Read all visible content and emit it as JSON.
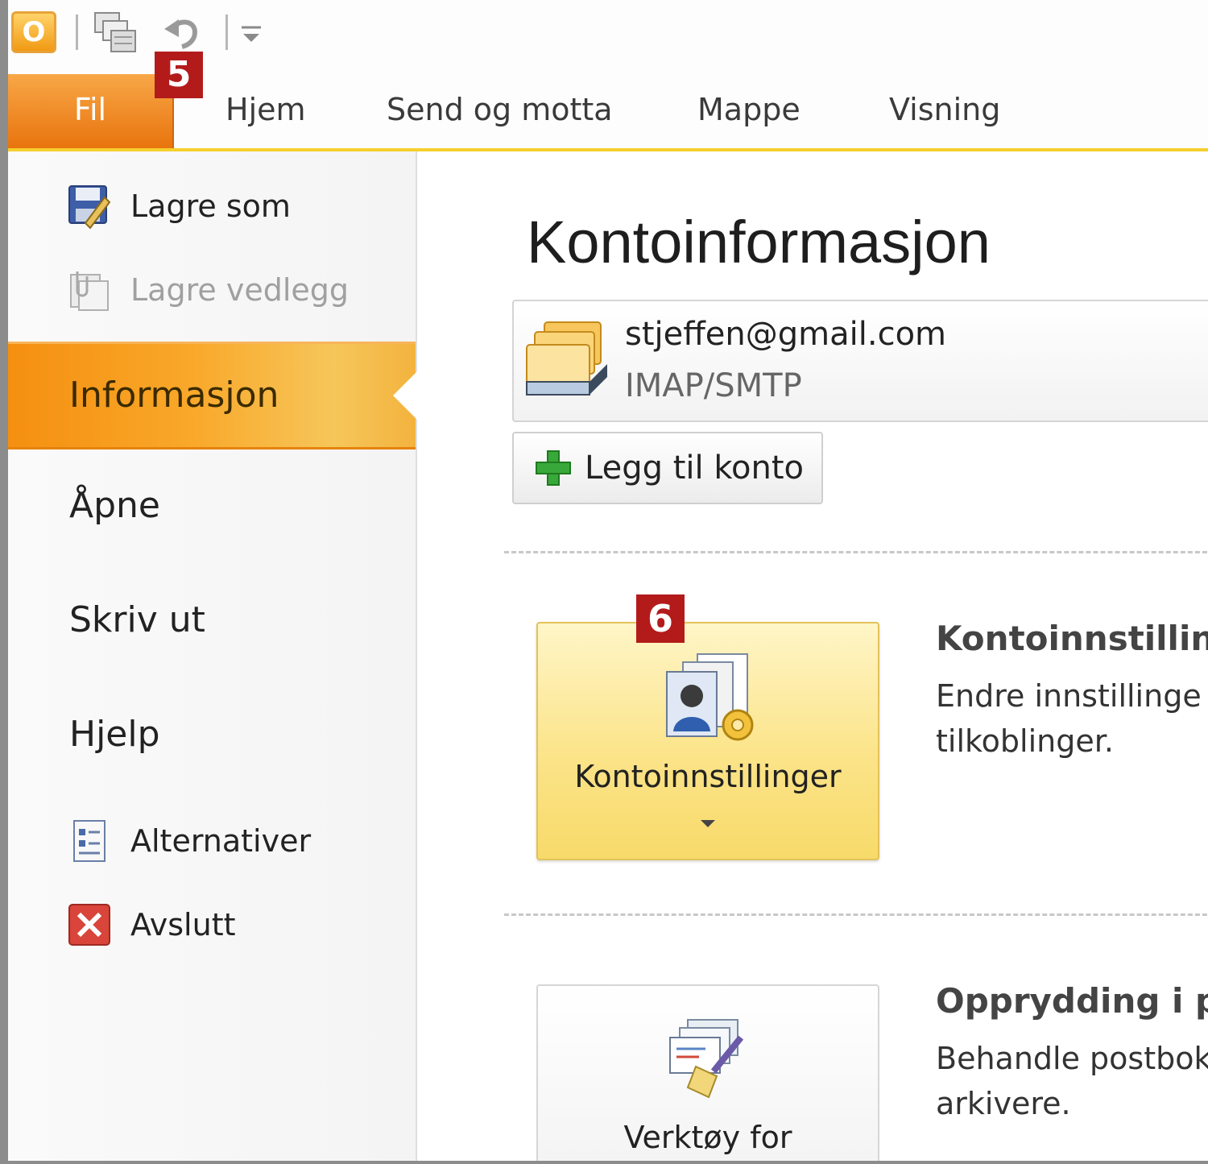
{
  "quick_access": {
    "logo_letter": "O",
    "icons": [
      "outlook-logo-icon",
      "send-receive-all-icon",
      "undo-icon",
      "customize-toolbar-icon"
    ]
  },
  "markers": {
    "file_tab": "5",
    "account_settings": "6"
  },
  "ribbon": {
    "tabs": [
      {
        "label": "Fil",
        "selected": true
      },
      {
        "label": "Hjem"
      },
      {
        "label": "Send og motta"
      },
      {
        "label": "Mappe"
      },
      {
        "label": "Visning"
      }
    ]
  },
  "backstage": {
    "commands_top": [
      {
        "label": "Lagre som",
        "icon": "save-as-icon",
        "enabled": true
      },
      {
        "label": "Lagre vedlegg",
        "icon": "save-attachments-icon",
        "enabled": false
      }
    ],
    "tabs": [
      {
        "label": "Informasjon",
        "selected": true
      },
      {
        "label": "Åpne"
      },
      {
        "label": "Skriv ut"
      },
      {
        "label": "Hjelp"
      }
    ],
    "commands_bottom": [
      {
        "label": "Alternativer",
        "icon": "options-icon"
      },
      {
        "label": "Avslutt",
        "icon": "exit-icon"
      }
    ]
  },
  "info": {
    "title": "Kontoinformasjon",
    "account": {
      "email": "stjeffen@gmail.com",
      "type": "IMAP/SMTP"
    },
    "add_account_label": "Legg til konto",
    "account_settings": {
      "button_label": "Kontoinnstillinger",
      "title": "Kontoinnstillin",
      "desc_line1": "Endre innstillinge",
      "desc_line2": "tilkoblinger."
    },
    "cleanup": {
      "button_label": "Verktøy for",
      "title": "Opprydding i p",
      "desc_line1": "Behandle postbok",
      "desc_line2": "arkivere."
    }
  },
  "colors": {
    "file_tab": "#e8740d",
    "selected_nav": "#f9a82a",
    "ribbon_underline": "#f5cf2e",
    "marker": "#b31b1b",
    "highlight_button": "#fbe48a"
  }
}
